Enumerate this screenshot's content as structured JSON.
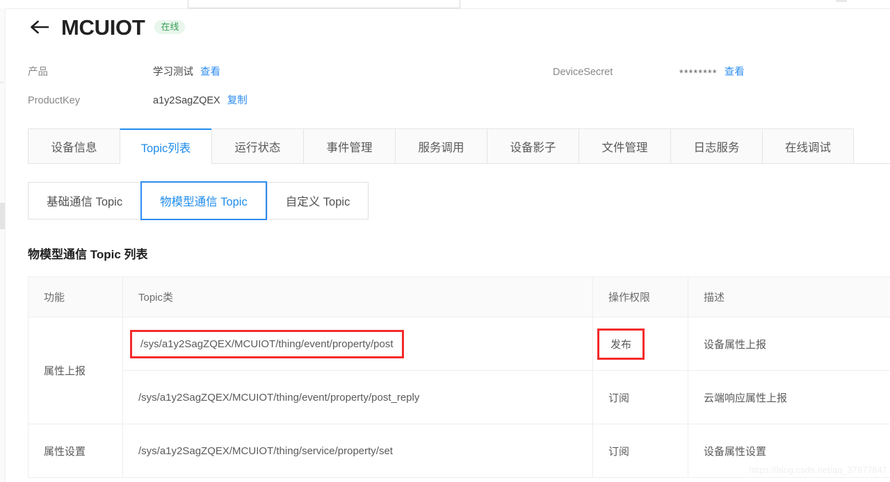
{
  "window": {
    "search_placeholder": ""
  },
  "header": {
    "back_icon": "arrow-left-icon",
    "title": "MCUIOT",
    "status": "在线"
  },
  "meta": {
    "product_label": "产品",
    "product_value": "学习测试",
    "product_link": "查看",
    "productkey_label": "ProductKey",
    "productkey_value": "a1y2SagZQEX",
    "productkey_link": "复制",
    "devicesecret_label": "DeviceSecret",
    "devicesecret_value": "********",
    "devicesecret_link": "查看"
  },
  "tabs": [
    {
      "label": "设备信息",
      "active": false
    },
    {
      "label": "Topic列表",
      "active": true
    },
    {
      "label": "运行状态",
      "active": false
    },
    {
      "label": "事件管理",
      "active": false
    },
    {
      "label": "服务调用",
      "active": false
    },
    {
      "label": "设备影子",
      "active": false
    },
    {
      "label": "文件管理",
      "active": false
    },
    {
      "label": "日志服务",
      "active": false
    },
    {
      "label": "在线调试",
      "active": false
    }
  ],
  "subtabs": [
    {
      "label": "基础通信 Topic",
      "active": false
    },
    {
      "label": "物模型通信 Topic",
      "active": true
    },
    {
      "label": "自定义 Topic",
      "active": false
    }
  ],
  "section": {
    "title": "物模型通信 Topic 列表"
  },
  "table": {
    "columns": [
      "功能",
      "Topic类",
      "操作权限",
      "描述"
    ],
    "rows": [
      {
        "func": "属性上报",
        "func_rowspan": 2,
        "topic": "/sys/a1y2SagZQEX/MCUIOT/thing/event/property/post",
        "topic_highlighted": true,
        "permission": "发布",
        "permission_highlighted": true,
        "description": "设备属性上报"
      },
      {
        "func": null,
        "topic": "/sys/a1y2SagZQEX/MCUIOT/thing/event/property/post_reply",
        "topic_highlighted": false,
        "permission": "订阅",
        "permission_highlighted": false,
        "description": "云端响应属性上报"
      },
      {
        "func": "属性设置",
        "func_rowspan": 1,
        "topic": "/sys/a1y2SagZQEX/MCUIOT/thing/service/property/set",
        "topic_highlighted": false,
        "permission": "订阅",
        "permission_highlighted": false,
        "description": "设备属性设置"
      }
    ]
  },
  "watermark": {
    "text": "https://blog.csdn.net/qq_37977847"
  },
  "colors": {
    "accent_blue": "#1f8ceb",
    "link_blue": "#2d8cf0",
    "highlight_red": "#f42b2b",
    "online_green": "#3a9e55",
    "online_green_bg": "#e8f6ec"
  }
}
